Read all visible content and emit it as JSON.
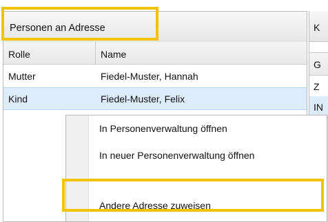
{
  "panel": {
    "title": "Personen an Adresse",
    "columns": {
      "role": "Rolle",
      "name": "Name"
    },
    "rows": [
      {
        "role": "Mutter",
        "name": "Fiedel-Muster, Hannah",
        "selected": false
      },
      {
        "role": "Kind",
        "name": "Fiedel-Muster, Felix",
        "selected": true
      }
    ]
  },
  "right_panel": {
    "title": "K",
    "column_header": "G",
    "cells": [
      "Z",
      "IN"
    ]
  },
  "context_menu": {
    "items": [
      "In Personenverwaltung öffnen",
      "In neuer Personenverwaltung öffnen",
      "",
      "Andere Adresse zuweisen"
    ]
  },
  "colors": {
    "highlight": "#f3c200",
    "selection": "#dcecfb"
  }
}
